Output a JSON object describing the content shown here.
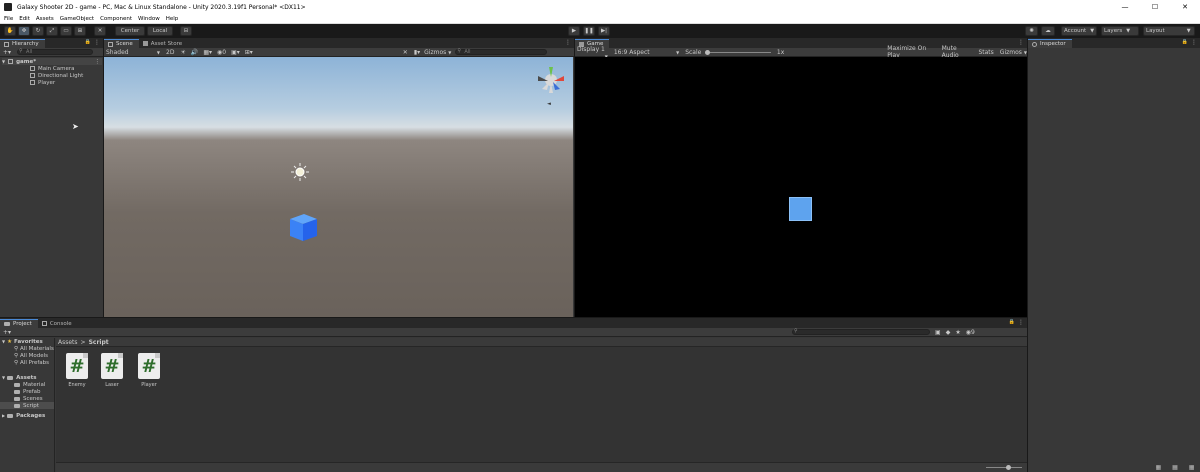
{
  "window": {
    "title": "Galaxy Shooter 2D - game - PC, Mac & Linux Standalone - Unity 2020.3.19f1 Personal* <DX11>",
    "controls": [
      "—",
      "☐",
      "✕"
    ]
  },
  "menu": [
    "File",
    "Edit",
    "Assets",
    "GameObject",
    "Component",
    "Window",
    "Help"
  ],
  "toolbar": {
    "pivot_label": "Center",
    "space_label": "Local",
    "account_label": "Account",
    "layers_label": "Layers",
    "layout_label": "Layout"
  },
  "hierarchy": {
    "tab_label": "Hierarchy",
    "search_placeholder": "All",
    "scene_name": "game*",
    "items": [
      "Main Camera",
      "Directional Light",
      "Player"
    ]
  },
  "scene": {
    "tabs": [
      "Scene",
      "Asset Store"
    ],
    "shading": "Shaded",
    "mode_2d": "2D",
    "gizmos_label": "Gizmos",
    "search_placeholder": "All",
    "colors": {
      "cube": "#3b82f6"
    }
  },
  "game": {
    "tab_label": "Game",
    "display": "Display 1",
    "aspect": "16:9 Aspect",
    "scale_label": "Scale",
    "scale_value": "1x",
    "toggles": [
      "Maximize On Play",
      "Mute Audio",
      "Stats",
      "Gizmos"
    ],
    "colors": {
      "cube": "#5ea3ee"
    }
  },
  "inspector": {
    "tab_label": "Inspector"
  },
  "project": {
    "tabs": [
      "Project",
      "Console"
    ],
    "favorites_label": "Favorites",
    "favorites": [
      "All Materials",
      "All Models",
      "All Prefabs"
    ],
    "assets_label": "Assets",
    "asset_folders": [
      "Material",
      "Prefab",
      "Scenes",
      "Script"
    ],
    "packages_label": "Packages",
    "breadcrumb": {
      "root": "Assets",
      "sep": ">",
      "current": "Script"
    },
    "scripts": [
      "Enemy",
      "Laser",
      "Player"
    ],
    "script_glyph": "#",
    "search_badge": "9"
  }
}
